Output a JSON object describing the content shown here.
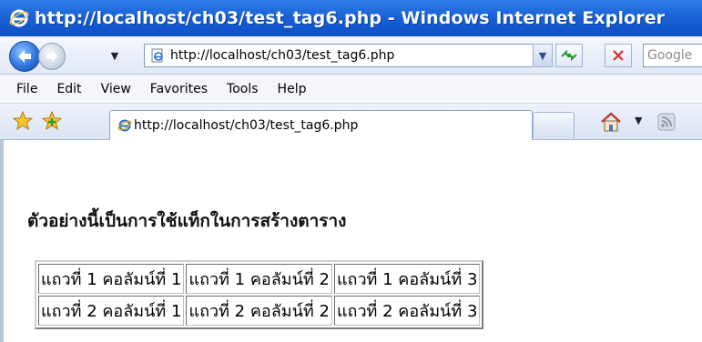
{
  "window": {
    "title": "http://localhost/ch03/test_tag6.php - Windows Internet Explorer"
  },
  "address_bar": {
    "url": "http://localhost/ch03/test_tag6.php",
    "search_placeholder": "Google"
  },
  "menu": {
    "items": [
      "File",
      "Edit",
      "View",
      "Favorites",
      "Tools",
      "Help"
    ]
  },
  "tab": {
    "label": "http://localhost/ch03/test_tag6.php"
  },
  "page": {
    "heading": "ตัวอย่างนี้เป็นการใช้แท็กในการสร้างตาราง",
    "table": {
      "rows": [
        [
          "แถวที่ 1 คอลัมน์ที่ 1",
          "แถวที่ 1 คอลัมน์ที่ 2",
          "แถวที่ 1 คอลัมน์ที่ 3"
        ],
        [
          "แถวที่ 2 คอลัมน์ที่ 1",
          "แถวที่ 2 คอลัมน์ที่ 2",
          "แถวที่ 2 คอลัมน์ที่ 3"
        ]
      ]
    }
  },
  "icons": {
    "browser": "ie-logo-icon",
    "back": "back-arrow-icon",
    "forward": "forward-arrow-icon",
    "page": "page-icon",
    "refresh": "refresh-icon",
    "stop": "stop-icon",
    "favorites": "favorites-star-icon",
    "add_favorite": "add-favorite-icon",
    "home": "home-icon",
    "feeds": "rss-feed-icon"
  },
  "colors": {
    "titlebar": "#1a62d6",
    "title_text": "#ffffff",
    "content_background": "#ffffff"
  }
}
